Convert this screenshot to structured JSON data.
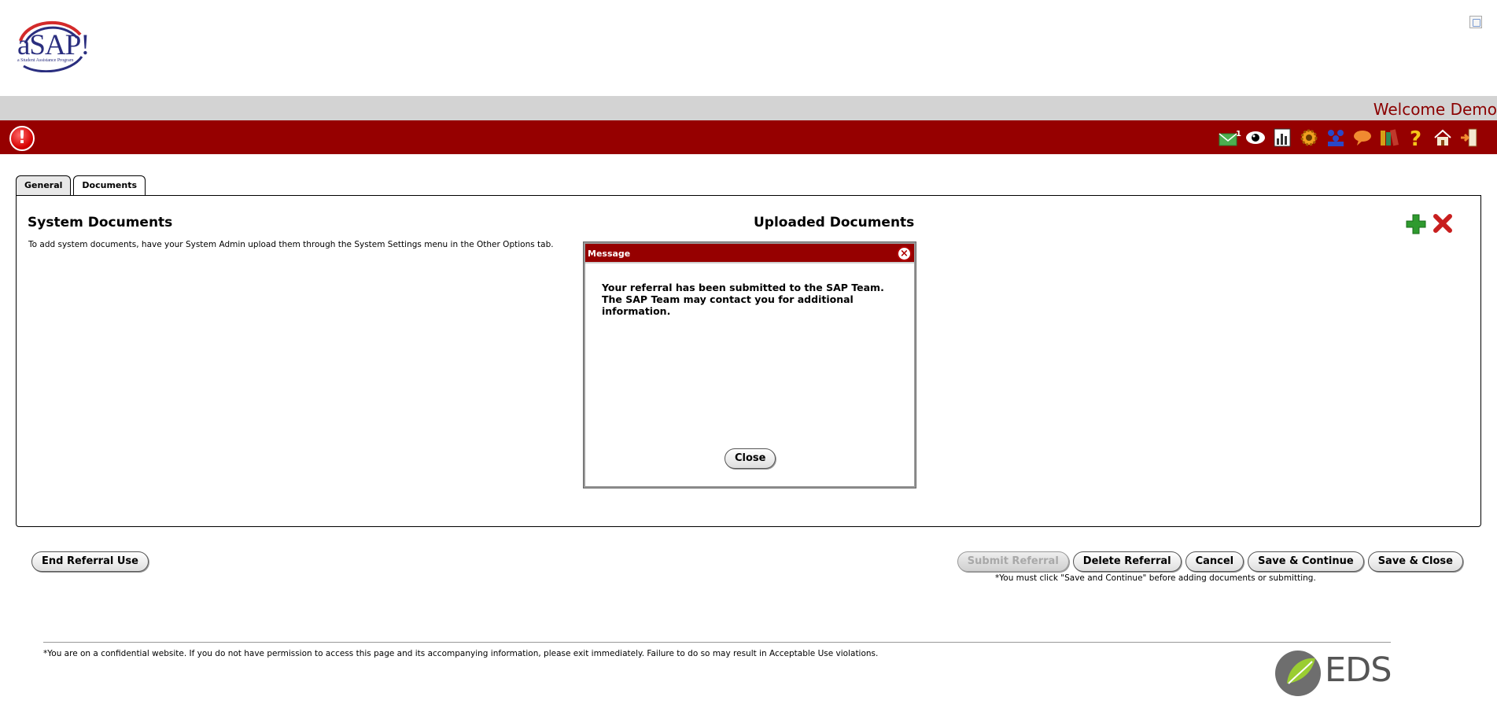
{
  "header": {
    "logo_text": "aSAP!",
    "logo_subtitle": "a Student Assistance Program",
    "welcome": "Welcome Demo",
    "mail_count": "1"
  },
  "tabs": [
    {
      "label": "General"
    },
    {
      "label": "Documents"
    }
  ],
  "system_documents": {
    "title": "System Documents",
    "description": "To add system documents, have your System Admin upload them through the System Settings menu in the Other Options tab."
  },
  "uploaded_documents": {
    "title": "Uploaded Documents"
  },
  "modal": {
    "title": "Message",
    "message": "Your referral has been submitted to the SAP Team. The SAP Team may contact you for additional information.",
    "close_label": "Close"
  },
  "buttons": {
    "end_referral": "End Referral Use",
    "submit_referral": "Submit Referral",
    "delete_referral": "Delete Referral",
    "cancel": "Cancel",
    "save_continue": "Save & Continue",
    "save_close": "Save & Close"
  },
  "save_note": "*You must click \"Save and Continue\" before adding documents or submitting.",
  "footer": {
    "notice": "*You are on a confidential website. If you do not have permission to access this page and its accompanying information, please exit immediately. Failure to do so may result in Acceptable Use violations.",
    "logo_text": "EDS"
  },
  "colors": {
    "brand_red": "#960000",
    "welcome_text": "#8b0000",
    "logo_blue": "#2a2e7f"
  }
}
